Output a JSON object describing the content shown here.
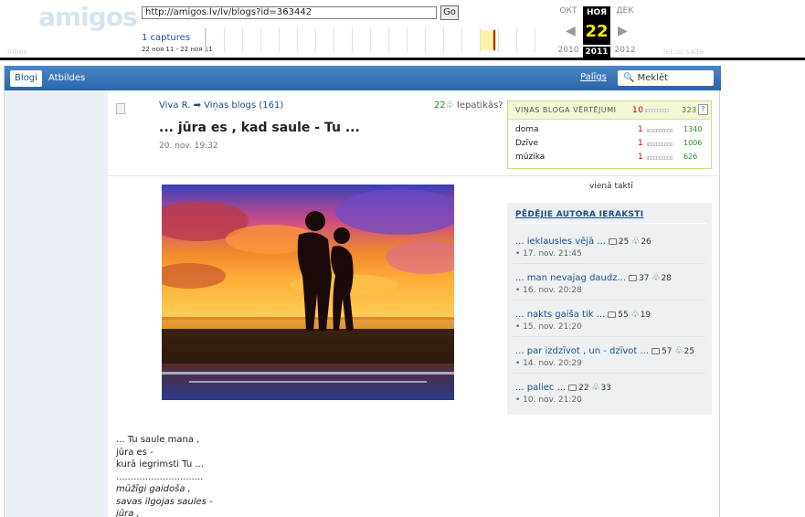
{
  "wayback": {
    "logo": "amigos",
    "url": "http://amigos.lv/lv/blogs?id=363442",
    "go_label": "Go",
    "captures": "1 captures",
    "range": "22 ноя 11 - 22 ноя 11",
    "months": [
      "ОКТ",
      "НОЯ",
      "ДЕК"
    ],
    "day": "22",
    "years": [
      "2010",
      "2011",
      "2012"
    ],
    "prev_arrow": "◀",
    "next_arrow": "▶",
    "ghost_left": "Inbox",
    "ghost_right": "Iet uz saita"
  },
  "nav": {
    "tabs": [
      "Blogi",
      "Atbildes"
    ],
    "help": "Palīgs",
    "search_placeholder": "Meklēt"
  },
  "post": {
    "author": "Viva R.",
    "arrow": "➡",
    "blog_link": "Viņas blogs (161)",
    "likes_count": "22",
    "likes_label": "Iepatikās?",
    "title": "... jūra es , kad saule - Tu ...",
    "date": "20. nov. 19:32",
    "caption_right": "vienā taktī"
  },
  "ratings": {
    "title": "VIŅAS BLOGA VĒRTĒJUMI",
    "total_left": "10",
    "total_right": "323+",
    "help": "?",
    "rows": [
      {
        "name": "doma",
        "left": "1",
        "right": "1340"
      },
      {
        "name": "Dzīve",
        "left": "1",
        "right": "1006"
      },
      {
        "name": "mūzika",
        "left": "1",
        "right": "626"
      }
    ]
  },
  "recent": {
    "title": "PĒDĒJIE AUTORA IERAKSTI",
    "posts": [
      {
        "title": "... ieklausies vējā ...",
        "comments": "25",
        "likes": "26",
        "date": "17. nov. 21:45"
      },
      {
        "title": "... man nevajag daudz...",
        "comments": "37",
        "likes": "28",
        "date": "16. nov. 20:28"
      },
      {
        "title": "... nakts gaiša tik ...",
        "comments": "55",
        "likes": "19",
        "date": "15. nov. 21:20"
      },
      {
        "title": "... par izdzīvot , un - dzīvot ...",
        "comments": "57",
        "likes": "25",
        "date": "14. nov. 20:29"
      },
      {
        "title": "... paliec ...",
        "comments": "22",
        "likes": "33",
        "date": "10. nov. 21:20"
      }
    ]
  },
  "poem": [
    "... Tu saule mana ,",
    "jūra es -",
    "kurā iegrimsti Tu ...",
    "..............................",
    "mūžīgi gaidoša ,",
    "savas ilgojas saules -",
    "jūra ,"
  ],
  "colors": {
    "nav_blue": "#2a65a8",
    "link_blue": "#1c4f8c",
    "rating_red": "#cc0000",
    "rating_green": "#2e8b2e"
  }
}
